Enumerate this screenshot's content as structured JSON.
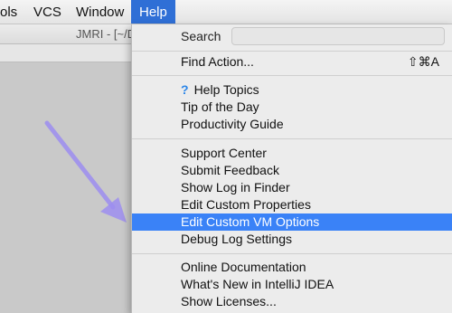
{
  "menubar": {
    "items": [
      {
        "label": "ols",
        "active": false
      },
      {
        "label": "VCS",
        "active": false
      },
      {
        "label": "Window",
        "active": false
      },
      {
        "label": "Help",
        "active": true
      }
    ]
  },
  "window": {
    "title": "JMRI - [~/D"
  },
  "help_menu": {
    "search": {
      "label": "Search",
      "value": ""
    },
    "find_action": {
      "label": "Find Action...",
      "shortcut": "⇧⌘A"
    },
    "group_docs": [
      {
        "label": "Help Topics",
        "icon": "question-mark-icon"
      },
      {
        "label": "Tip of the Day"
      },
      {
        "label": "Productivity Guide"
      }
    ],
    "group_support": [
      {
        "label": "Support Center"
      },
      {
        "label": "Submit Feedback"
      },
      {
        "label": "Show Log in Finder"
      },
      {
        "label": "Edit Custom Properties"
      },
      {
        "label": "Edit Custom VM Options",
        "highlighted": true
      },
      {
        "label": "Debug Log Settings"
      }
    ],
    "group_info": [
      {
        "label": "Online Documentation"
      },
      {
        "label": "What's New in IntelliJ IDEA"
      },
      {
        "label": "Show Licenses..."
      }
    ]
  },
  "colors": {
    "highlight": "#3a82f7",
    "menubar_active": "#2f6fd6",
    "annotation_arrow": "#9d8ef0"
  }
}
